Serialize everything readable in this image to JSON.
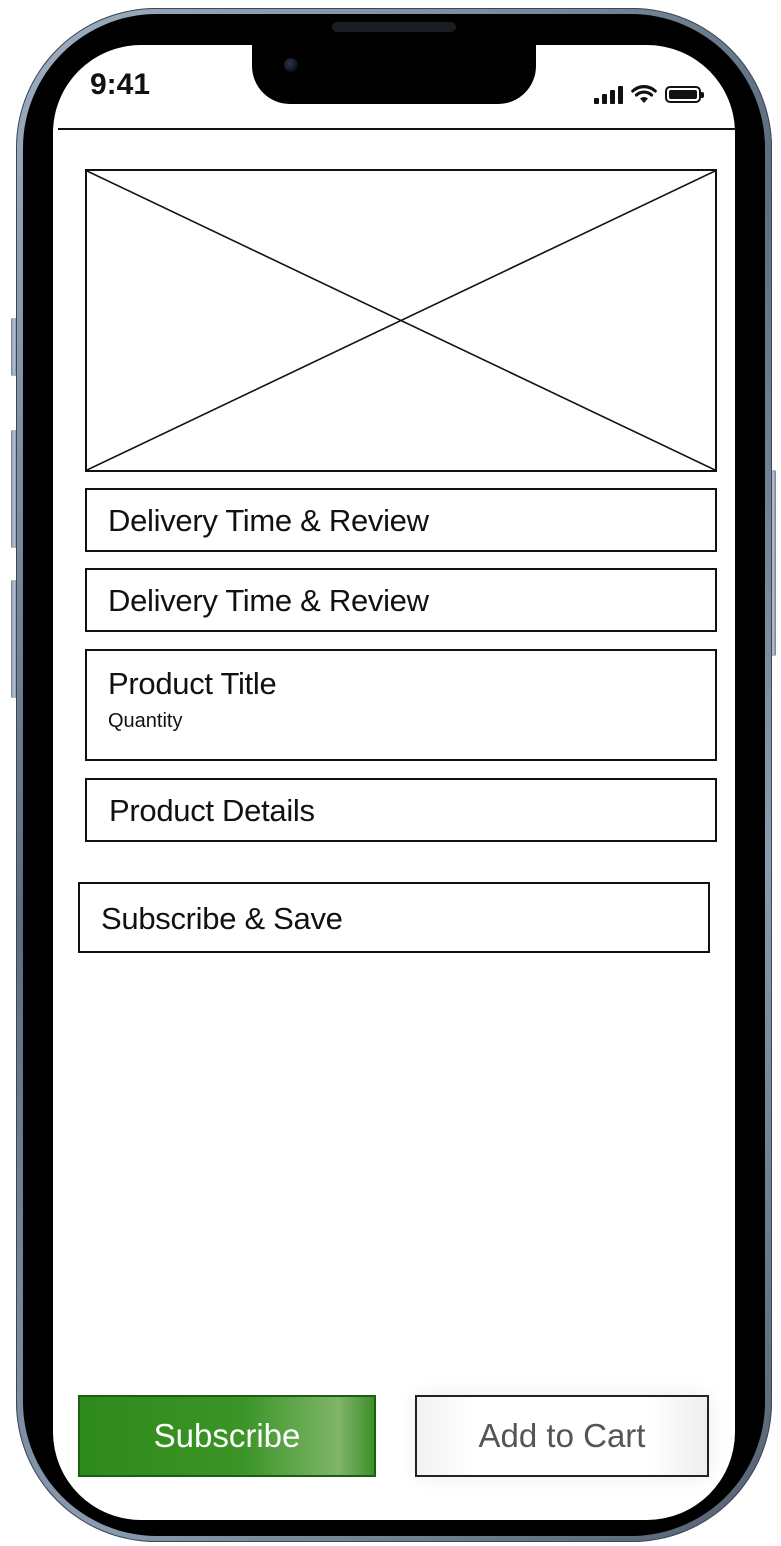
{
  "status_bar": {
    "time": "9:41",
    "signal_icon": "cellular-signal-icon",
    "wifi_icon": "wifi-icon",
    "battery_icon": "battery-icon"
  },
  "product": {
    "image_icon": "image-placeholder-icon",
    "sections": [
      {
        "label": "Delivery Time & Review"
      },
      {
        "label": "Delivery Time & Review"
      },
      {
        "label": "Product Title",
        "sublabel": "Quantity"
      },
      {
        "label": "Product Details"
      }
    ],
    "subscribe_save_label": "Subscribe & Save"
  },
  "actions": {
    "subscribe_label": "Subscribe",
    "add_to_cart_label": "Add to Cart",
    "subscribe_color": "#2e8a1b"
  }
}
